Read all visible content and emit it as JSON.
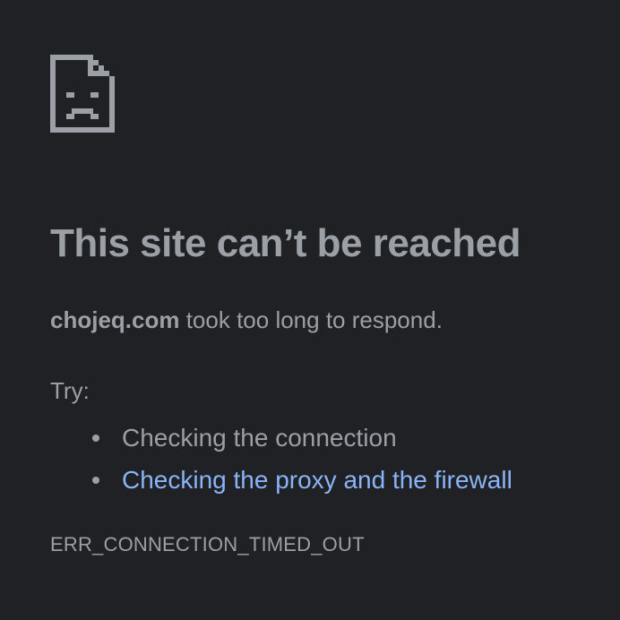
{
  "icon": {
    "name": "sad-page-icon",
    "color": "#9aa0a6"
  },
  "colors": {
    "background": "#202124",
    "text": "#9aa0a6",
    "link": "#8ab4f8"
  },
  "error_page": {
    "headline": "This site can’t be reached",
    "host": "chojeq.com",
    "message": " took too long to respond.",
    "try_label": "Try:",
    "suggestions": [
      {
        "label": "Checking the connection",
        "is_link": false
      },
      {
        "label": "Checking the proxy and the firewall",
        "is_link": true
      }
    ],
    "error_code": "ERR_CONNECTION_TIMED_OUT"
  }
}
